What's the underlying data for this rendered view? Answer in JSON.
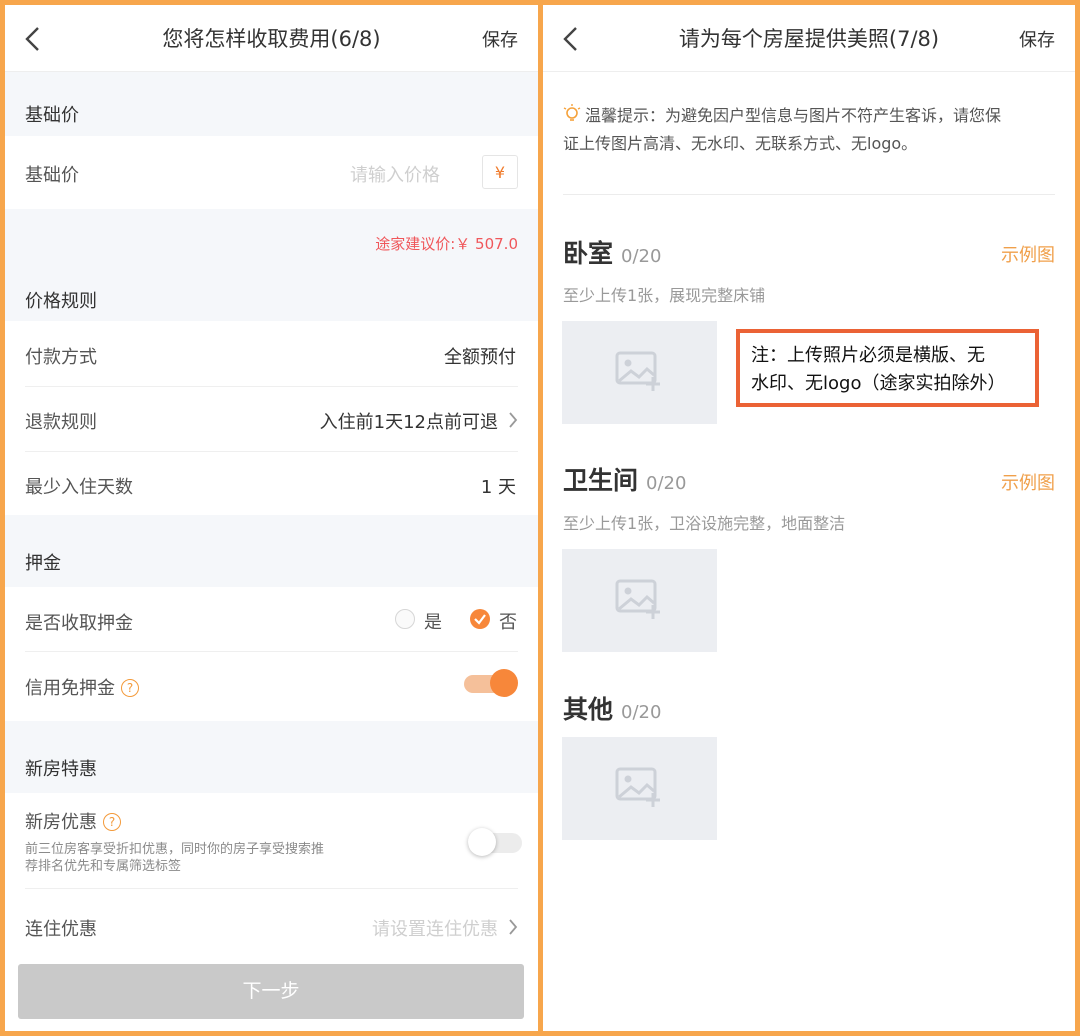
{
  "left": {
    "header": {
      "title": "您将怎样收取费用(6/8)",
      "save": "保存"
    },
    "base_section": "基础价",
    "base_row": {
      "label": "基础价",
      "placeholder": "请输入价格",
      "currency": "¥"
    },
    "suggested_price": "途家建议价:￥ 507.0",
    "rules_section": "价格规则",
    "payment": {
      "label": "付款方式",
      "value": "全额预付"
    },
    "refund": {
      "label": "退款规则",
      "value": "入住前1天12点前可退"
    },
    "min_stay": {
      "label": "最少入住天数",
      "value": "1 天"
    },
    "deposit_section": "押金",
    "deposit_row": {
      "label": "是否收取押金",
      "yes": "是",
      "no": "否",
      "selected": "否"
    },
    "credit_row": {
      "label": "信用免押金",
      "enabled": true
    },
    "newhouse_section": "新房特惠",
    "newhouse_row": {
      "label": "新房优惠",
      "desc_line1": "前三位房客享受折扣优惠，同时你的房子享受搜索推",
      "desc_line2": "荐排名优先和专属筛选标签",
      "enabled": false
    },
    "consecutive": {
      "label": "连住优惠",
      "value": "请设置连住优惠"
    },
    "next_button": "下一步"
  },
  "right": {
    "header": {
      "title": "请为每个房屋提供美照(7/8)",
      "save": "保存"
    },
    "tip_line1": "温馨提示：为避免因户型信息与图片不符产生客诉，请您保",
    "tip_line2": "证上传图片高清、无水印、无联系方式、无logo。",
    "bedroom": {
      "title": "卧室",
      "count": "0/20",
      "example": "示例图",
      "desc": "至少上传1张，展现完整床铺"
    },
    "bathroom": {
      "title": "卫生间",
      "count": "0/20",
      "example": "示例图",
      "desc": "至少上传1张，卫浴设施完整，地面整洁"
    },
    "other": {
      "title": "其他",
      "count": "0/20"
    },
    "note_line1": "注：上传照片必须是横版、无",
    "note_line2": "水印、无logo（途家实拍除外）"
  },
  "colors": {
    "accent": "#f7873a",
    "border": "#f7a64c",
    "red_note": "#eb6235",
    "suggest": "#f0575b"
  },
  "icons": [
    "back-chevron-icon",
    "lightbulb-icon",
    "image-add-icon",
    "help-circle-icon",
    "chevron-right-icon",
    "checkmark-icon"
  ]
}
